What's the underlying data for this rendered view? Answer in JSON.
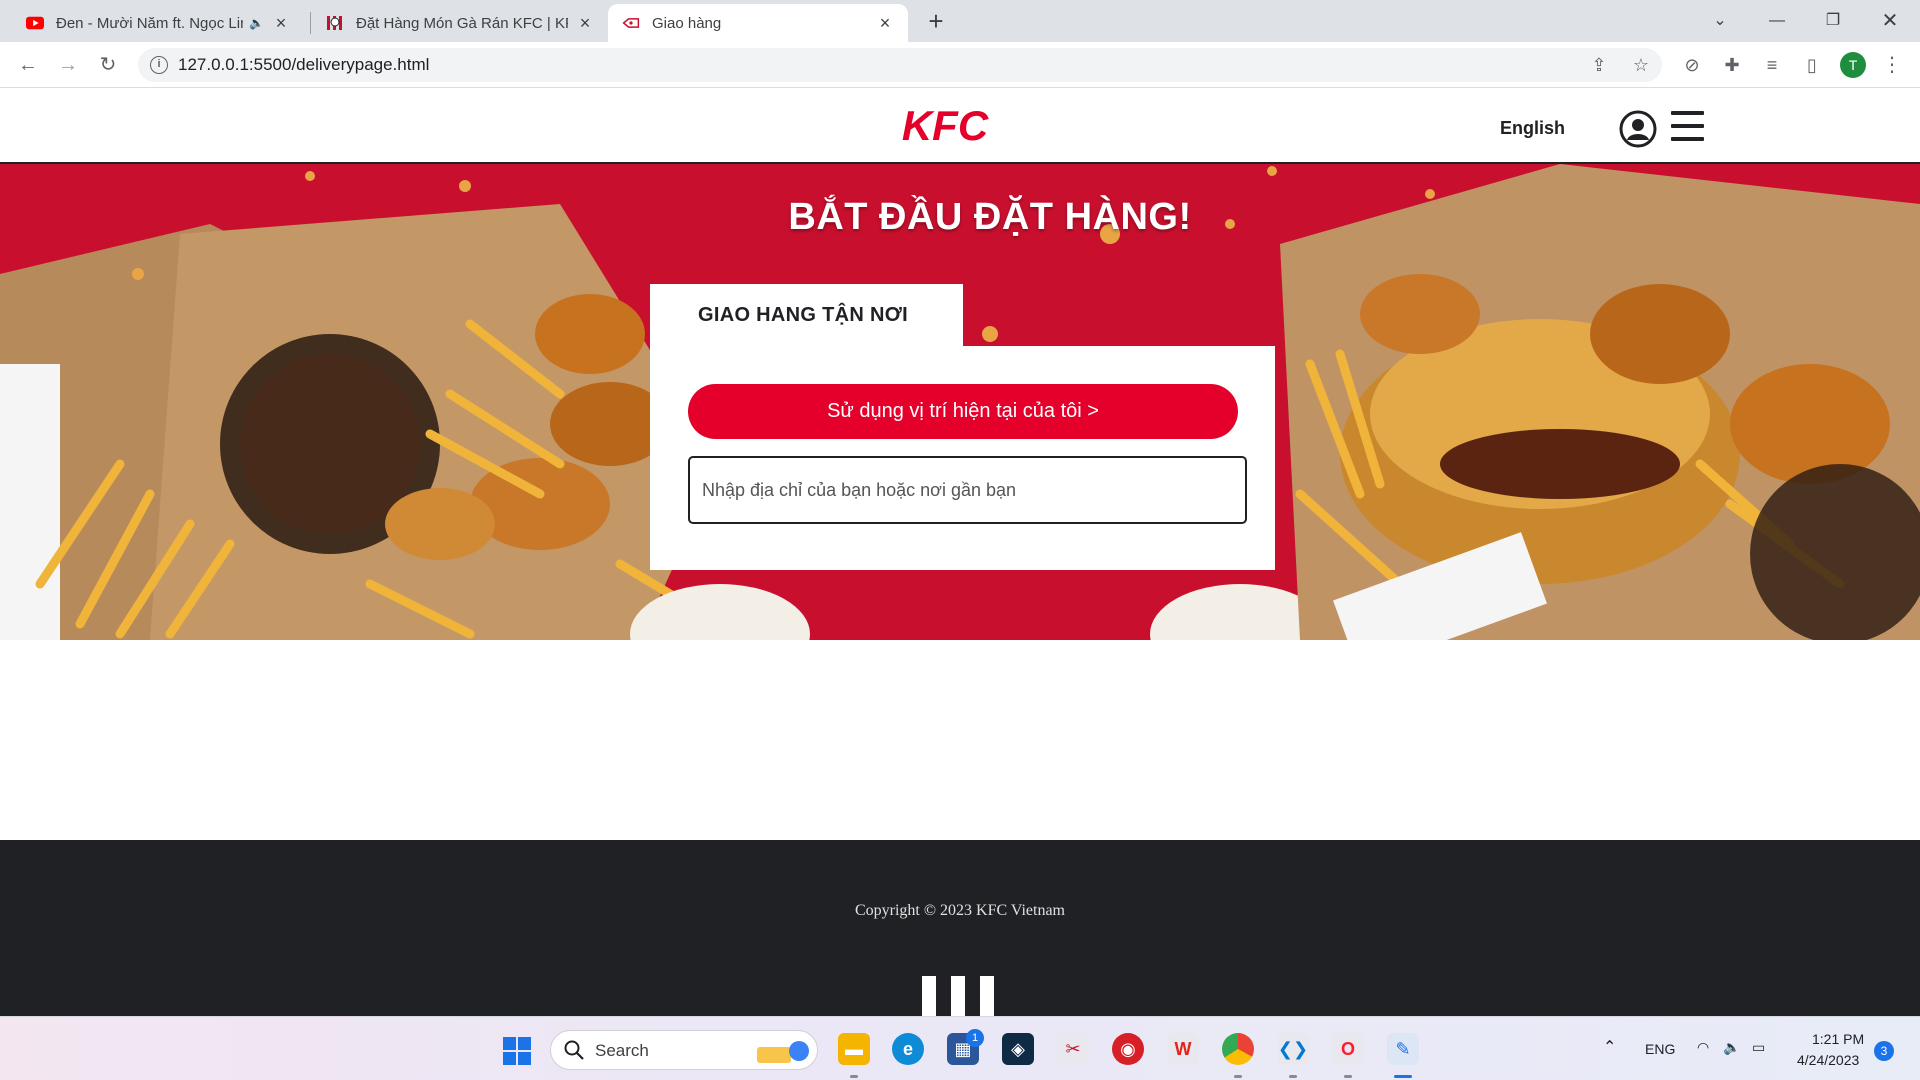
{
  "browser": {
    "tabs": [
      {
        "title": "Đen - Mười Năm ft. Ngọc Linh",
        "favicon": "youtube-icon",
        "audio": true
      },
      {
        "title": "Đặt Hàng Món Gà Rán KFC | KFC",
        "favicon": "kfc-icon",
        "audio": false
      },
      {
        "title": "Giao hàng",
        "favicon": "kfc-delivery-icon",
        "audio": false,
        "active": true
      }
    ],
    "url": "127.0.0.1:5500/deliverypage.html",
    "profile_initial": "T"
  },
  "header": {
    "logo_text": "KFC",
    "language": "English"
  },
  "hero": {
    "title": "BẮT ĐẦU ĐẶT HÀNG!",
    "tab_label": "GIAO HANG TẬN NƠI",
    "use_location_button": "Sử dụng vị trí hiện tại của tôi >",
    "address_placeholder": "Nhập địa chỉ của bạn hoặc nơi gần bạn"
  },
  "footer": {
    "copyright": "Copyright © 2023 KFC Vietnam"
  },
  "taskbar": {
    "search_label": "Search",
    "store_badge": "1",
    "language": "ENG",
    "time": "1:21 PM",
    "date": "4/24/2023",
    "notification_count": "3"
  },
  "colors": {
    "kfc_red": "#e4002b",
    "hero_red": "#c8102e",
    "footer_bg": "#202124"
  }
}
